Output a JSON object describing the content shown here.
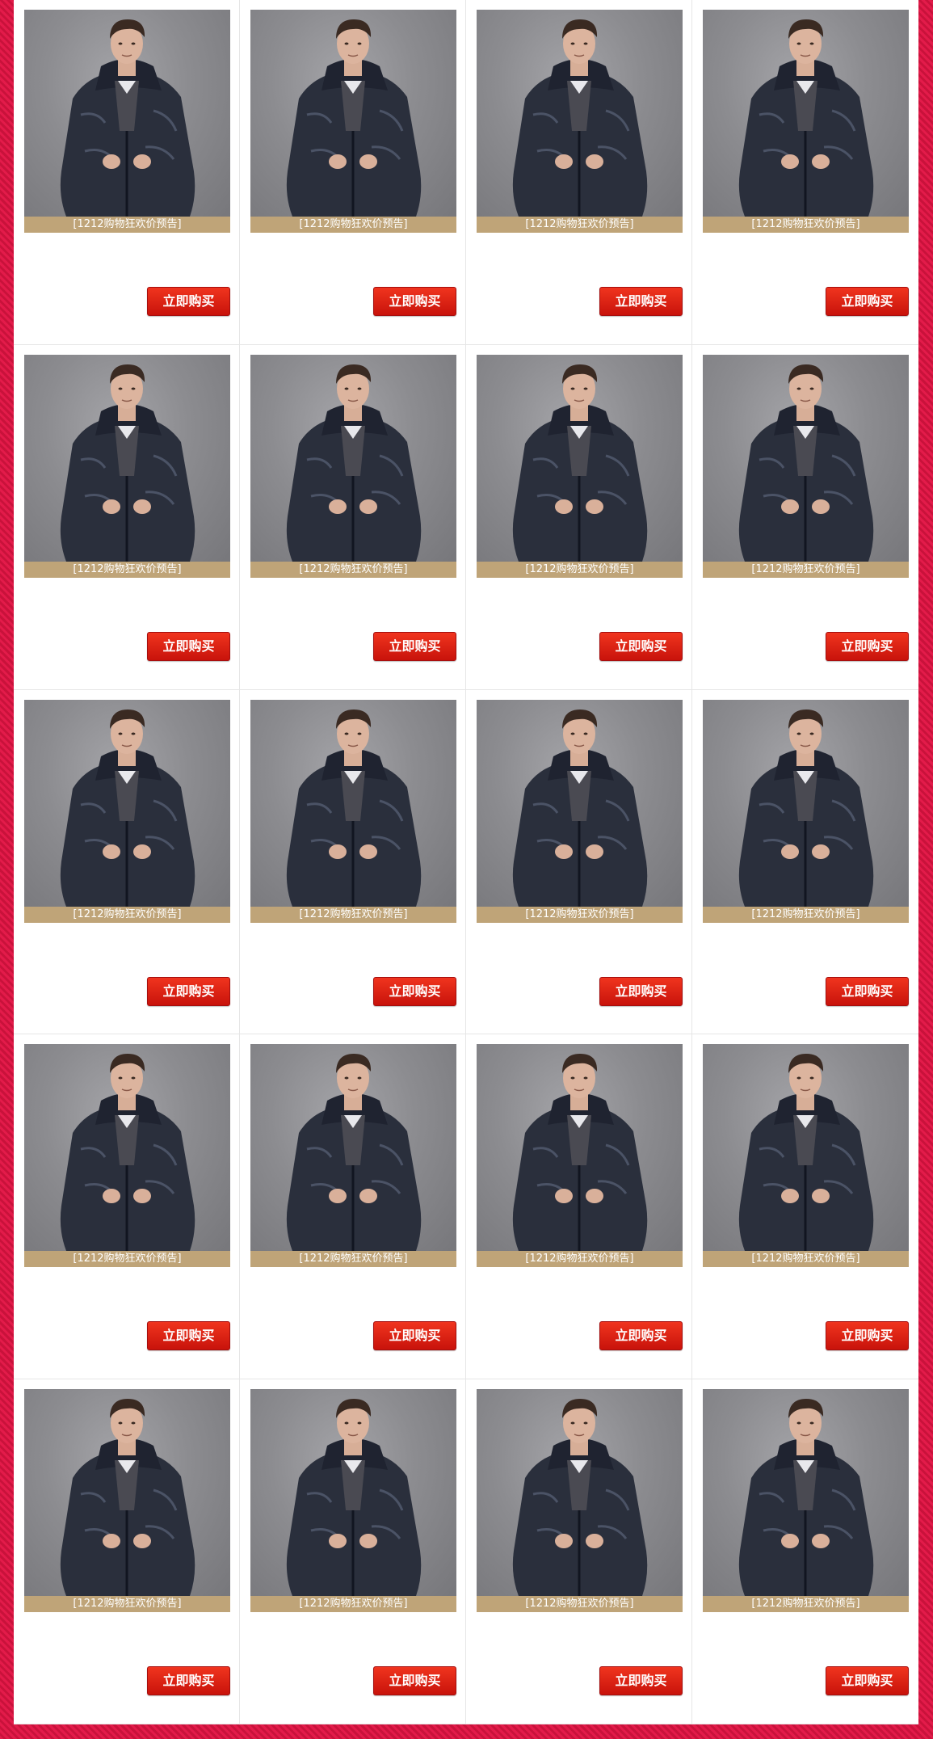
{
  "products": [
    {
      "caption": "[1212购物狂欢价预告]",
      "buy_label": "立即购买"
    },
    {
      "caption": "[1212购物狂欢价预告]",
      "buy_label": "立即购买"
    },
    {
      "caption": "[1212购物狂欢价预告]",
      "buy_label": "立即购买"
    },
    {
      "caption": "[1212购物狂欢价预告]",
      "buy_label": "立即购买"
    },
    {
      "caption": "[1212购物狂欢价预告]",
      "buy_label": "立即购买"
    },
    {
      "caption": "[1212购物狂欢价预告]",
      "buy_label": "立即购买"
    },
    {
      "caption": "[1212购物狂欢价预告]",
      "buy_label": "立即购买"
    },
    {
      "caption": "[1212购物狂欢价预告]",
      "buy_label": "立即购买"
    },
    {
      "caption": "[1212购物狂欢价预告]",
      "buy_label": "立即购买"
    },
    {
      "caption": "[1212购物狂欢价预告]",
      "buy_label": "立即购买"
    },
    {
      "caption": "[1212购物狂欢价预告]",
      "buy_label": "立即购买"
    },
    {
      "caption": "[1212购物狂欢价预告]",
      "buy_label": "立即购买"
    },
    {
      "caption": "[1212购物狂欢价预告]",
      "buy_label": "立即购买"
    },
    {
      "caption": "[1212购物狂欢价预告]",
      "buy_label": "立即购买"
    },
    {
      "caption": "[1212购物狂欢价预告]",
      "buy_label": "立即购买"
    },
    {
      "caption": "[1212购物狂欢价预告]",
      "buy_label": "立即购买"
    },
    {
      "caption": "[1212购物狂欢价预告]",
      "buy_label": "立即购买"
    },
    {
      "caption": "[1212购物狂欢价预告]",
      "buy_label": "立即购买"
    },
    {
      "caption": "[1212购物狂欢价预告]",
      "buy_label": "立即购买"
    },
    {
      "caption": "[1212购物狂欢价预告]",
      "buy_label": "立即购买"
    }
  ],
  "colors": {
    "border_accent": "#d9143f",
    "caption_bg": "#bfa478",
    "button_bg": "#d91d10",
    "photo_bg": "#8c8c90",
    "jacket": "#2a2f3c"
  },
  "icons": {
    "product_photo": "man-in-leather-jacket-photo"
  }
}
